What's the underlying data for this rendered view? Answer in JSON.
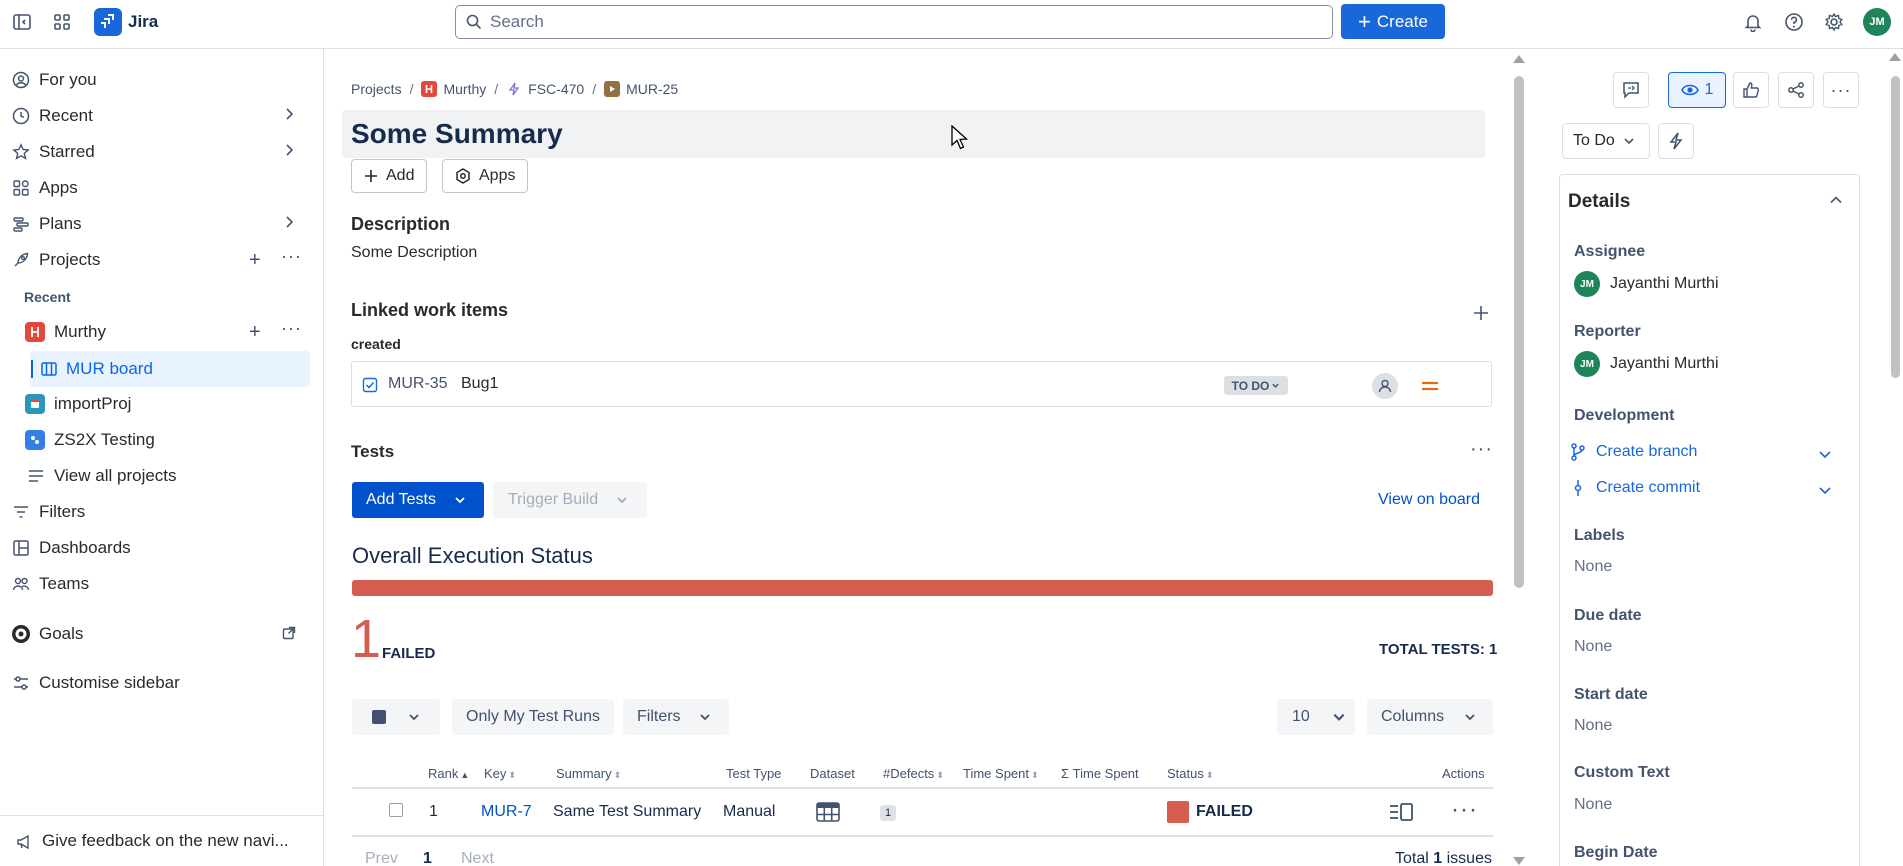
{
  "topbar": {
    "app_name": "Jira",
    "search_placeholder": "Search",
    "create_label": "Create",
    "user_initials": "JM"
  },
  "sidebar": {
    "items": {
      "for_you": "For you",
      "recent": "Recent",
      "starred": "Starred",
      "apps": "Apps",
      "plans": "Plans",
      "projects": "Projects"
    },
    "recent_label": "Recent",
    "projects": {
      "murthy": "Murthy",
      "mur_board": "MUR board",
      "importproj": "importProj",
      "zs2x": "ZS2X Testing",
      "view_all": "View all projects"
    },
    "bottom_items": {
      "filters": "Filters",
      "dashboards": "Dashboards",
      "teams": "Teams",
      "goals": "Goals",
      "customise": "Customise sidebar"
    },
    "feedback": "Give feedback on the new navi..."
  },
  "breadcrumb": {
    "projects": "Projects",
    "murthy": "Murthy",
    "parent": "FSC-470",
    "current": "MUR-25"
  },
  "issue": {
    "title": "Some Summary",
    "add_label": "Add",
    "apps_label": "Apps",
    "description_heading": "Description",
    "description": "Some Description",
    "linked_heading": "Linked work items",
    "link_type": "created",
    "linked_item": {
      "key": "MUR-35",
      "summary": "Bug1",
      "status": "TO DO"
    }
  },
  "tests": {
    "heading": "Tests",
    "add_tests": "Add Tests",
    "trigger_build": "Trigger Build",
    "view_on_board": "View on board",
    "overall_heading": "Overall Execution Status",
    "failed_count": "1",
    "failed_label": "FAILED",
    "total_label": "TOTAL TESTS: 1",
    "only_my_runs": "Only My Test Runs",
    "filters": "Filters",
    "page_size": "10",
    "columns": "Columns",
    "headers": {
      "rank": "Rank",
      "key": "Key",
      "summary": "Summary",
      "test_type": "Test Type",
      "dataset": "Dataset",
      "defects": "#Defects",
      "time_spent": "Time Spent",
      "sum_time_spent": "Σ Time Spent",
      "status": "Status",
      "actions": "Actions"
    },
    "row": {
      "rank": "1",
      "key": "MUR-7",
      "summary": "Same Test Summary",
      "test_type": "Manual",
      "defects": "1",
      "status": "FAILED"
    },
    "pagination": {
      "prev": "Prev",
      "page": "1",
      "next": "Next",
      "total_prefix": "Total",
      "total_count": "1",
      "total_suffix": "issues"
    }
  },
  "right_panel": {
    "watch_count": "1",
    "status": "To Do",
    "details_heading": "Details",
    "assignee_label": "Assignee",
    "assignee": "Jayanthi Murthi",
    "assignee_initials": "JM",
    "reporter_label": "Reporter",
    "reporter": "Jayanthi Murthi",
    "reporter_initials": "JM",
    "development_label": "Development",
    "create_branch": "Create branch",
    "create_commit": "Create commit",
    "labels_label": "Labels",
    "labels_value": "None",
    "due_date_label": "Due date",
    "due_date_value": "None",
    "start_date_label": "Start date",
    "start_date_value": "None",
    "custom_text_label": "Custom Text",
    "custom_text_value": "None",
    "begin_date_label": "Begin Date"
  },
  "colors": {
    "brand_blue": "#1868db",
    "failed_red": "#d45d50",
    "avatar_green": "#1f845a",
    "selected_bg": "#e9f2ff"
  }
}
